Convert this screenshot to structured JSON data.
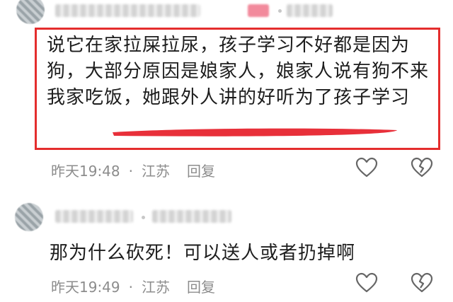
{
  "comments": [
    {
      "text": "说它在家拉屎拉尿，孩子学习不好都是因为狗，大部分原因是娘家人，娘家人说有狗不来我家吃饭，她跟外人讲的好听为了孩子学习",
      "time": "昨天19:48",
      "location": "江苏",
      "reply_label": "回复"
    },
    {
      "text": "那为什么砍死！可以送人或者扔掉啊",
      "time": "昨天19:49",
      "location": "江苏",
      "reply_label": "回复"
    }
  ],
  "separator": "·",
  "icons": [
    "like-heart-icon",
    "dislike-broken-heart-icon"
  ],
  "colors": {
    "highlight_border": "#e42d2d",
    "underline": "#e8303a",
    "meta_text": "#8c8c8c"
  }
}
